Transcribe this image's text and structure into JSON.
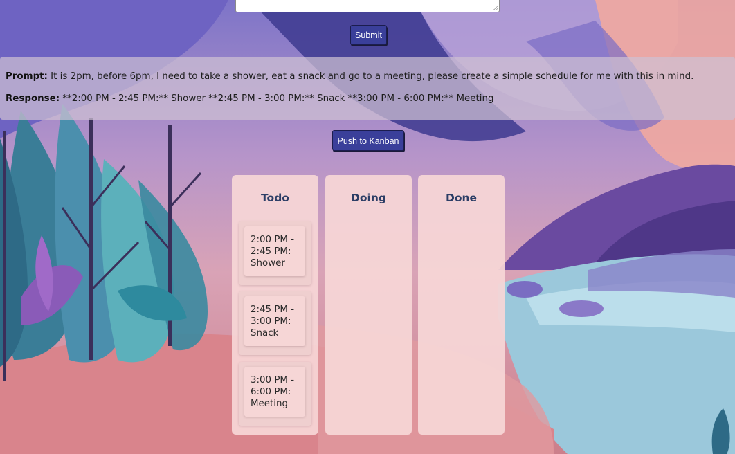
{
  "form": {
    "submit_label": "Submit"
  },
  "response": {
    "prompt_label": "Prompt:",
    "prompt_text": " It is 2pm, before 6pm, I need to take a shower, eat a snack and go to a meeting, please create a simple schedule for me with this in mind.",
    "response_label": "Response:",
    "response_text": " **2:00 PM - 2:45 PM:** Shower **2:45 PM - 3:00 PM:** Snack **3:00 PM - 6:00 PM:** Meeting"
  },
  "push_button_label": "Push to Kanban",
  "board": {
    "columns": [
      {
        "title": "Todo",
        "cards": [
          [
            "2:00 PM -",
            "2:45 PM:",
            "Shower"
          ],
          [
            "2:45 PM -",
            "3:00 PM:",
            "Snack"
          ],
          [
            "3:00 PM -",
            "6:00 PM:",
            "Meeting"
          ]
        ]
      },
      {
        "title": "Doing",
        "cards": []
      },
      {
        "title": "Done",
        "cards": []
      }
    ]
  },
  "colors": {
    "button_bg": "#3a3f9a",
    "column_bg": "#f6d6d6",
    "column_title": "#2c3e66"
  }
}
